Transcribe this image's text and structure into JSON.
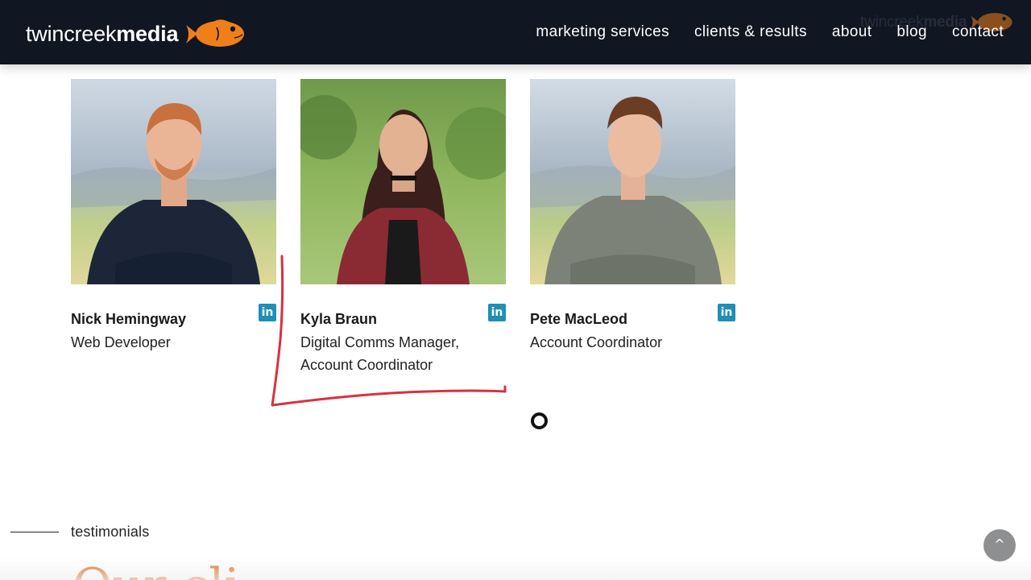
{
  "brand": {
    "logo_light": "twincreek",
    "logo_bold": "media",
    "accent_color": "#ef7f1a",
    "header_bg": "#101622"
  },
  "nav": {
    "items": [
      {
        "label": "marketing services"
      },
      {
        "label": "clients & results"
      },
      {
        "label": "about"
      },
      {
        "label": "blog"
      },
      {
        "label": "contact"
      }
    ]
  },
  "team": [
    {
      "name": "Nick Hemingway",
      "role_line1": "Web Developer",
      "role_line2": "",
      "social_icon": "linkedin-icon"
    },
    {
      "name": "Kyla Braun",
      "role_line1": "Digital Comms Manager,",
      "role_line2": "Account Coordinator",
      "social_icon": "linkedin-icon"
    },
    {
      "name": "Pete MacLeod",
      "role_line1": "Account Coordinator",
      "role_line2": "",
      "social_icon": "linkedin-icon"
    }
  ],
  "linkedin_glyph": "in",
  "testimonials": {
    "label": "testimonials",
    "heading_partial": "Our cli"
  },
  "scroll_top_glyph": "^",
  "colors": {
    "annotation": "#d9303f",
    "linkedin": "#1f8fb5",
    "heading": "#e2702a"
  }
}
